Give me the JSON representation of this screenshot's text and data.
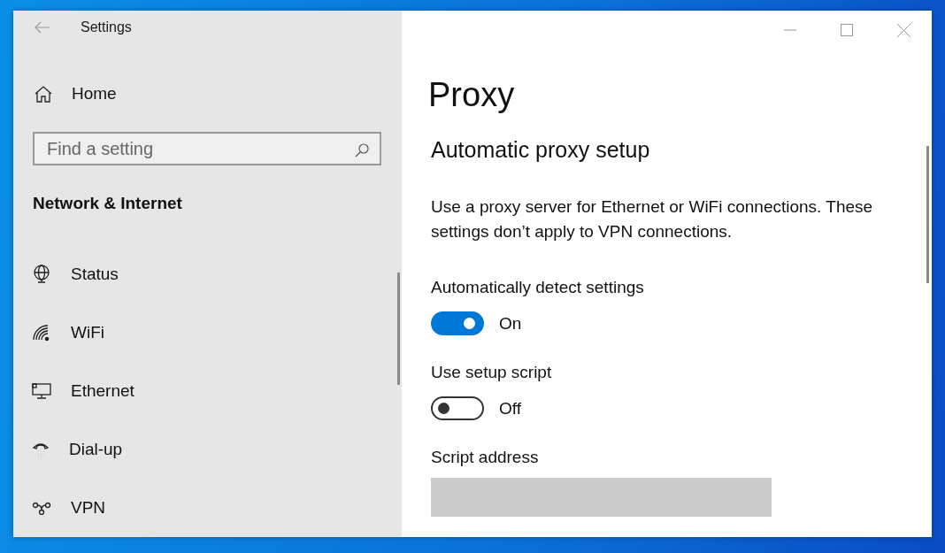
{
  "window": {
    "title": "Settings"
  },
  "sidebar": {
    "home": {
      "label": "Home"
    },
    "search": {
      "placeholder": "Find a setting"
    },
    "section_title": "Network & Internet",
    "items": [
      {
        "label": "Status",
        "kind": "globe"
      },
      {
        "label": "WiFi",
        "kind": "wifi"
      },
      {
        "label": "Ethernet",
        "kind": "ethernet"
      },
      {
        "label": "Dial-up",
        "kind": "dialup"
      },
      {
        "label": "VPN",
        "kind": "vpn"
      }
    ]
  },
  "content": {
    "title": "Proxy",
    "section_title": "Automatic proxy setup",
    "description": "Use a proxy server for Ethernet or WiFi connections. These settings don’t apply to VPN connections.",
    "toggles": [
      {
        "label": "Automatically detect settings",
        "on": true,
        "state_text": "On"
      },
      {
        "label": "Use setup script",
        "on": false,
        "state_text": "Off"
      }
    ],
    "script_address": {
      "label": "Script address",
      "disabled": true
    }
  }
}
